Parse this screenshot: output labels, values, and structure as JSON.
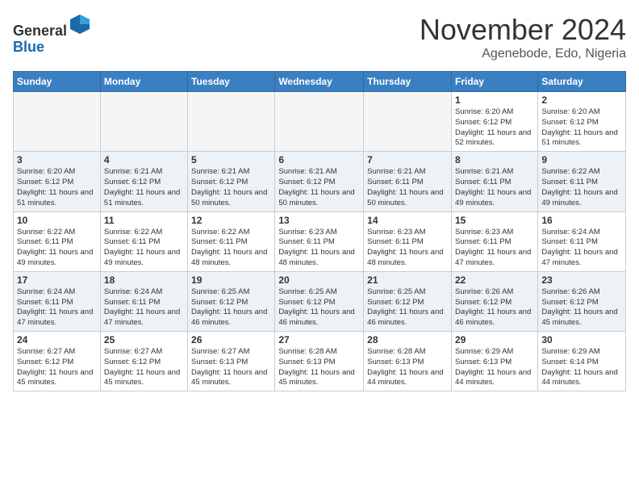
{
  "header": {
    "logo_line1": "General",
    "logo_line2": "Blue",
    "month": "November 2024",
    "location": "Agenebode, Edo, Nigeria"
  },
  "weekdays": [
    "Sunday",
    "Monday",
    "Tuesday",
    "Wednesday",
    "Thursday",
    "Friday",
    "Saturday"
  ],
  "weeks": [
    [
      {
        "day": "",
        "info": ""
      },
      {
        "day": "",
        "info": ""
      },
      {
        "day": "",
        "info": ""
      },
      {
        "day": "",
        "info": ""
      },
      {
        "day": "",
        "info": ""
      },
      {
        "day": "1",
        "info": "Sunrise: 6:20 AM\nSunset: 6:12 PM\nDaylight: 11 hours\nand 52 minutes."
      },
      {
        "day": "2",
        "info": "Sunrise: 6:20 AM\nSunset: 6:12 PM\nDaylight: 11 hours\nand 51 minutes."
      }
    ],
    [
      {
        "day": "3",
        "info": "Sunrise: 6:20 AM\nSunset: 6:12 PM\nDaylight: 11 hours\nand 51 minutes."
      },
      {
        "day": "4",
        "info": "Sunrise: 6:21 AM\nSunset: 6:12 PM\nDaylight: 11 hours\nand 51 minutes."
      },
      {
        "day": "5",
        "info": "Sunrise: 6:21 AM\nSunset: 6:12 PM\nDaylight: 11 hours\nand 50 minutes."
      },
      {
        "day": "6",
        "info": "Sunrise: 6:21 AM\nSunset: 6:12 PM\nDaylight: 11 hours\nand 50 minutes."
      },
      {
        "day": "7",
        "info": "Sunrise: 6:21 AM\nSunset: 6:11 PM\nDaylight: 11 hours\nand 50 minutes."
      },
      {
        "day": "8",
        "info": "Sunrise: 6:21 AM\nSunset: 6:11 PM\nDaylight: 11 hours\nand 49 minutes."
      },
      {
        "day": "9",
        "info": "Sunrise: 6:22 AM\nSunset: 6:11 PM\nDaylight: 11 hours\nand 49 minutes."
      }
    ],
    [
      {
        "day": "10",
        "info": "Sunrise: 6:22 AM\nSunset: 6:11 PM\nDaylight: 11 hours\nand 49 minutes."
      },
      {
        "day": "11",
        "info": "Sunrise: 6:22 AM\nSunset: 6:11 PM\nDaylight: 11 hours\nand 49 minutes."
      },
      {
        "day": "12",
        "info": "Sunrise: 6:22 AM\nSunset: 6:11 PM\nDaylight: 11 hours\nand 48 minutes."
      },
      {
        "day": "13",
        "info": "Sunrise: 6:23 AM\nSunset: 6:11 PM\nDaylight: 11 hours\nand 48 minutes."
      },
      {
        "day": "14",
        "info": "Sunrise: 6:23 AM\nSunset: 6:11 PM\nDaylight: 11 hours\nand 48 minutes."
      },
      {
        "day": "15",
        "info": "Sunrise: 6:23 AM\nSunset: 6:11 PM\nDaylight: 11 hours\nand 47 minutes."
      },
      {
        "day": "16",
        "info": "Sunrise: 6:24 AM\nSunset: 6:11 PM\nDaylight: 11 hours\nand 47 minutes."
      }
    ],
    [
      {
        "day": "17",
        "info": "Sunrise: 6:24 AM\nSunset: 6:11 PM\nDaylight: 11 hours\nand 47 minutes."
      },
      {
        "day": "18",
        "info": "Sunrise: 6:24 AM\nSunset: 6:11 PM\nDaylight: 11 hours\nand 47 minutes."
      },
      {
        "day": "19",
        "info": "Sunrise: 6:25 AM\nSunset: 6:12 PM\nDaylight: 11 hours\nand 46 minutes."
      },
      {
        "day": "20",
        "info": "Sunrise: 6:25 AM\nSunset: 6:12 PM\nDaylight: 11 hours\nand 46 minutes."
      },
      {
        "day": "21",
        "info": "Sunrise: 6:25 AM\nSunset: 6:12 PM\nDaylight: 11 hours\nand 46 minutes."
      },
      {
        "day": "22",
        "info": "Sunrise: 6:26 AM\nSunset: 6:12 PM\nDaylight: 11 hours\nand 46 minutes."
      },
      {
        "day": "23",
        "info": "Sunrise: 6:26 AM\nSunset: 6:12 PM\nDaylight: 11 hours\nand 45 minutes."
      }
    ],
    [
      {
        "day": "24",
        "info": "Sunrise: 6:27 AM\nSunset: 6:12 PM\nDaylight: 11 hours\nand 45 minutes."
      },
      {
        "day": "25",
        "info": "Sunrise: 6:27 AM\nSunset: 6:12 PM\nDaylight: 11 hours\nand 45 minutes."
      },
      {
        "day": "26",
        "info": "Sunrise: 6:27 AM\nSunset: 6:13 PM\nDaylight: 11 hours\nand 45 minutes."
      },
      {
        "day": "27",
        "info": "Sunrise: 6:28 AM\nSunset: 6:13 PM\nDaylight: 11 hours\nand 45 minutes."
      },
      {
        "day": "28",
        "info": "Sunrise: 6:28 AM\nSunset: 6:13 PM\nDaylight: 11 hours\nand 44 minutes."
      },
      {
        "day": "29",
        "info": "Sunrise: 6:29 AM\nSunset: 6:13 PM\nDaylight: 11 hours\nand 44 minutes."
      },
      {
        "day": "30",
        "info": "Sunrise: 6:29 AM\nSunset: 6:14 PM\nDaylight: 11 hours\nand 44 minutes."
      }
    ]
  ]
}
